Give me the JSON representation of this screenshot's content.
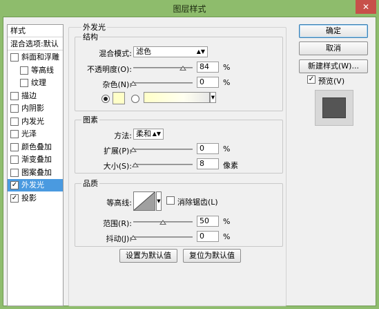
{
  "window": {
    "title": "图层样式",
    "close_label": "✕"
  },
  "left_panel": {
    "header": "样式",
    "blend_options": "混合选项:默认",
    "items": [
      {
        "label": "斜面和浮雕",
        "checked": false,
        "sub": false,
        "selected": false
      },
      {
        "label": "等高线",
        "checked": false,
        "sub": true,
        "selected": false
      },
      {
        "label": "纹理",
        "checked": false,
        "sub": true,
        "selected": false
      },
      {
        "label": "描边",
        "checked": false,
        "sub": false,
        "selected": false
      },
      {
        "label": "内阴影",
        "checked": false,
        "sub": false,
        "selected": false
      },
      {
        "label": "内发光",
        "checked": false,
        "sub": false,
        "selected": false
      },
      {
        "label": "光泽",
        "checked": false,
        "sub": false,
        "selected": false
      },
      {
        "label": "颜色叠加",
        "checked": false,
        "sub": false,
        "selected": false
      },
      {
        "label": "渐变叠加",
        "checked": false,
        "sub": false,
        "selected": false
      },
      {
        "label": "图案叠加",
        "checked": false,
        "sub": false,
        "selected": false
      },
      {
        "label": "外发光",
        "checked": true,
        "sub": false,
        "selected": true
      },
      {
        "label": "投影",
        "checked": true,
        "sub": false,
        "selected": false
      }
    ]
  },
  "outer_glow": {
    "title": "外发光",
    "structure": {
      "title": "结构",
      "blend_mode_label": "混合模式:",
      "blend_mode_value": "滤色",
      "opacity_label": "不透明度(O):",
      "opacity_value": "84",
      "opacity_unit": "%",
      "opacity_level": 84,
      "noise_label": "杂色(N):",
      "noise_value": "0",
      "noise_unit": "%",
      "noise_level": 0,
      "color_selected": "solid",
      "glow_color": "#ffffc8"
    },
    "elements": {
      "title": "图素",
      "method_label": "方法:",
      "method_value": "柔和",
      "spread_label": "扩展(P):",
      "spread_value": "0",
      "spread_unit": "%",
      "spread_level": 0,
      "size_label": "大小(S):",
      "size_value": "8",
      "size_unit": "像素",
      "size_level": 3
    },
    "quality": {
      "title": "品质",
      "contour_label": "等高线:",
      "antialias_label": "消除锯齿(L)",
      "range_label": "范围(R):",
      "range_value": "50",
      "range_unit": "%",
      "range_level": 50,
      "jitter_label": "抖动(J):",
      "jitter_value": "0",
      "jitter_unit": "%",
      "jitter_level": 0
    },
    "set_default": "设置为默认值",
    "reset_default": "复位为默认值"
  },
  "buttons": {
    "ok": "确定",
    "cancel": "取消",
    "new_style": "新建样式(W)...",
    "preview_label": "预览(V)",
    "preview_checked": true
  }
}
